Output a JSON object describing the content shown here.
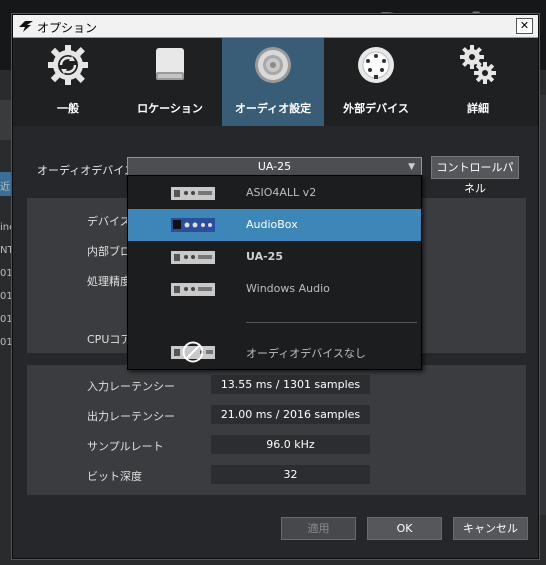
{
  "window": {
    "title": "オプション",
    "close_glyph": "✕"
  },
  "toolbar": {
    "items": [
      {
        "label": "一般",
        "icon": "refresh-gear-icon",
        "active": false
      },
      {
        "label": "ロケーション",
        "icon": "drive-icon",
        "active": false
      },
      {
        "label": "オーディオ設定",
        "icon": "speaker-icon",
        "active": true
      },
      {
        "label": "外部デバイス",
        "icon": "midi-port-icon",
        "active": false
      },
      {
        "label": "詳細",
        "icon": "gears-icon",
        "active": false
      }
    ]
  },
  "audio_device": {
    "label": "オーディオデバイス",
    "selected": "UA-25",
    "control_panel_label": "コントロールパネル"
  },
  "device_panel": {
    "labels": [
      "デバイスブ",
      "内部ブロ",
      "処理精度",
      "CPUコア"
    ]
  },
  "latency": {
    "rows": [
      {
        "label": "入力レーテンシー",
        "value": "13.55 ms / 1301 samples"
      },
      {
        "label": "出力レーテンシー",
        "value": "21.00 ms / 2016 samples"
      },
      {
        "label": "サンプルレート",
        "value": "96.0 kHz"
      },
      {
        "label": "ビット深度",
        "value": "32"
      }
    ]
  },
  "dropdown": {
    "options": [
      {
        "label": "ASIO4ALL v2",
        "selected": false,
        "bold": false
      },
      {
        "label": "AudioBox",
        "selected": true,
        "bold": false
      },
      {
        "label": "UA-25",
        "selected": false,
        "bold": true
      },
      {
        "label": "Windows Audio",
        "selected": false,
        "bold": false
      }
    ],
    "no_device": "オーディオデバイスなし"
  },
  "buttons": {
    "apply": "適用",
    "ok": "OK",
    "cancel": "キャンセル"
  },
  "background": {
    "left_texts": [
      "近",
      "ine",
      "NTE",
      "01",
      "01",
      "01",
      "01"
    ]
  },
  "colors": {
    "accent": "#3c86b8",
    "toolbar_active": "#3a5d77"
  }
}
